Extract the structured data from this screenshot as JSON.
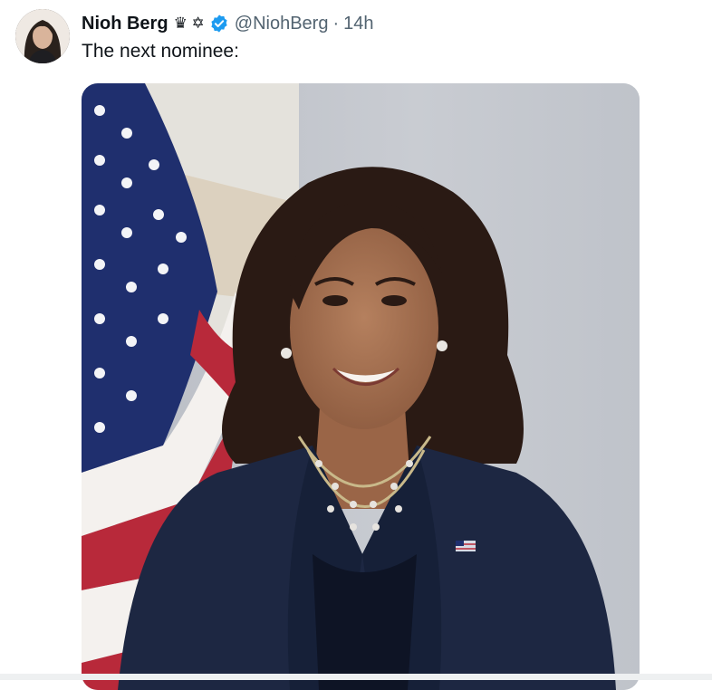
{
  "post": {
    "author_name": "Nioh Berg",
    "author_emoji": "♛ ✡",
    "handle": "@NiohBerg",
    "separator": "·",
    "timestamp": "14h",
    "text": "The next nominee:"
  },
  "colors": {
    "verified_badge": "#1d9bf0",
    "secondary_text": "#536471",
    "primary_text": "#0f1419"
  },
  "icons": {
    "verified": "verified-badge-icon"
  }
}
